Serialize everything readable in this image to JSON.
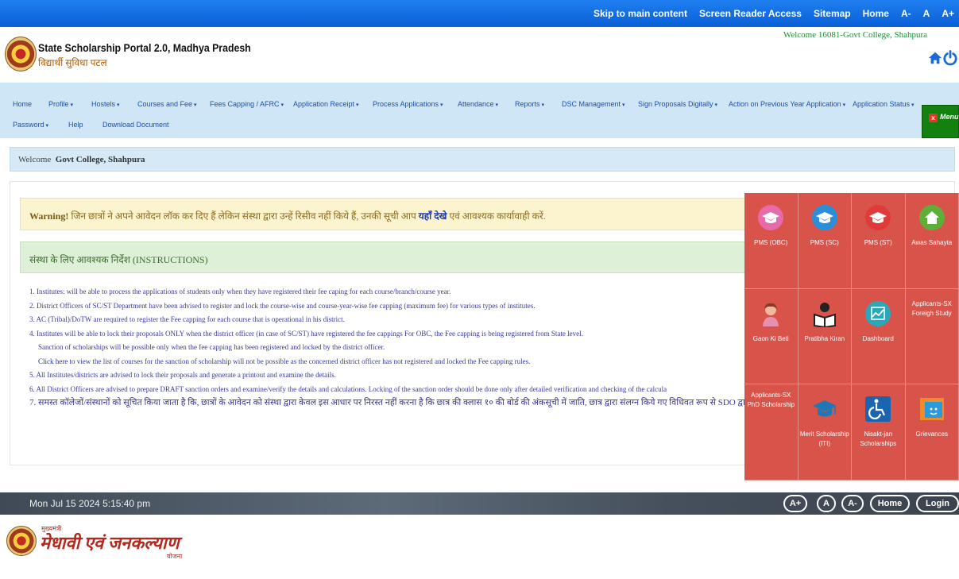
{
  "topbar": {
    "skip": "Skip to main content",
    "reader": "Screen Reader Access",
    "sitemap": "Sitemap",
    "home": "Home",
    "font_minus": "A-",
    "font_normal": "A",
    "font_plus": "A+"
  },
  "header": {
    "title": "State Scholarship Portal 2.0, Madhya Pradesh",
    "subtitle": "विद्यार्थी सुविधा पटल",
    "welcome": "Welcome 16081-Govt College, Shahpura"
  },
  "nav": {
    "items": [
      "Home",
      "Profile",
      "Hostels",
      "Courses and Fee",
      "Fees Capping / AFRC",
      "Application Receipt",
      "Process Applications",
      "Attendance",
      "Reports",
      "DSC Management",
      "Sign Proposals Digitally",
      "Action on Previous Year Application",
      "Application Status",
      "Password",
      "Help",
      "Download Document"
    ],
    "menu": "Menu",
    "menu_close": "x"
  },
  "welcome_bar": {
    "prefix": "Welcome",
    "name": "Govt College, Shahpura"
  },
  "warning": {
    "label": "Warning!",
    "text": " जिन छात्रों ने अपने आवेदन लॉक कर दिए हैं लेकिन संस्था द्वारा उन्हें रिसीव नहीं किये हैं, उनकी सूची आप ",
    "link": "यहाँ देखे",
    "suffix": " एवं आवश्यक कार्यावाही करें."
  },
  "instructions": {
    "heading": "संस्था के लिए आवश्यक निर्देश (INSTRUCTIONS)",
    "lines": [
      "1. Institutes:  will be able to process the applications of students only when they have registered their fee caping for each course/branch/course year.",
      "2. District Officers of  SC/ST Department have been advised to register and lock the course-wise and course-year-wise fee capping (maximum fee) for various types of institutes.",
      "3. AC (Tribal)/DoTW are required  to register the Fee capping for each course that is operational in his district.",
      "4. Institutes will be able to lock their proposals  ONLY when the district officer (in case of SC/ST) have registered the fee cappings  For OBC, the Fee capping is being registered from State level.",
      "Sanction of scholarships will be possible only when the fee capping has been registered and locked by the district officer.",
      " to view the list of courses for the sanction of scholarship will not be possible as the concerned district officer has not registered and locked the Fee capping rules.",
      "5. All Institutes/districts are advised to lock their proposals and generate a printout and examine the details.",
      "6. All District Officers are advised to prepare DRAFT sanction orders and examine/verify the details and calculations. Locking of the sanction order should be done only after detailed verification and checking of the calcula",
      "7. समस्त कॉलेजों/संस्थानों को सूचित किया जाता है कि, छात्रों के आवेदन को संस्था द्वारा केवल इस आधार पर निरस्त नहीं करना है कि छात्र की क्लास १० की बोर्ड की अंकसूची में जाति, छात्र द्वारा संलग्न किये गए विधिवत रूप से SDO द्वारा जा"
    ],
    "click_here": "Click here"
  },
  "schemes": [
    {
      "label": "PMS (OBC)",
      "icon": "graduation-cap-pink-icon",
      "color": "#e86aa8",
      "badge": "PMS (OBC)"
    },
    {
      "label": "PMS (SC)",
      "icon": "graduation-cap-blue-icon",
      "color": "#2a8fd8",
      "badge": "PMS (SC)"
    },
    {
      "label": "PMS (ST)",
      "icon": "graduation-cap-red-icon",
      "color": "#e03a3a",
      "badge": "PMS (ST)"
    },
    {
      "label": "Awas Sahayta",
      "icon": "house-icon",
      "color": "#5fae3a"
    },
    {
      "label": "Gaon Ki Beti",
      "icon": "girl-icon",
      "color": "#f0a8a0"
    },
    {
      "label": "Pratibha Kiran",
      "icon": "reading-girl-icon",
      "color": "#222222"
    },
    {
      "label": "Dashboard",
      "icon": "chart-icon",
      "color": "#2aa8b8"
    },
    {
      "label": "Applicants-SX Foreigh Study",
      "icon": "",
      "color": ""
    },
    {
      "label": "Applicants-SX PhD Scholarship",
      "icon": "",
      "color": ""
    },
    {
      "label": "Merit Scholarship (ITI)",
      "icon": "mortarboard-icon",
      "color": "#1e78b8"
    },
    {
      "label": "Nisakt-jan Scholarships",
      "icon": "wheelchair-icon",
      "color": "#1a64b0"
    },
    {
      "label": "Grievances",
      "icon": "grievance-icon",
      "color": "#2a9ad8"
    }
  ],
  "footer": {
    "datetime": "Mon Jul 15 2024 5:15:40 pm",
    "btn_plus": "A+",
    "btn_normal": "A",
    "btn_minus": "A-",
    "btn_home": "Home",
    "btn_login": "Login"
  },
  "bottom_brand": {
    "small": "मुख्यमंत्री",
    "main": "मेधावी एवं जनकल्याण",
    "sub": "योजना"
  }
}
